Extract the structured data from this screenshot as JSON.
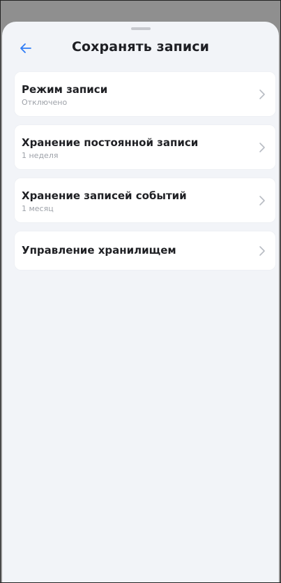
{
  "header": {
    "title": "Сохранять записи",
    "back_icon": "arrow-left-icon"
  },
  "colors": {
    "accent": "#2f7cf6",
    "background": "#f2f4f8",
    "overlay": "#8f8f8f",
    "card": "#ffffff",
    "title_text": "#1e1f24",
    "subtitle_text": "#9ea2a9",
    "chevron": "#b8bcc3"
  },
  "items": [
    {
      "label": "Режим записи",
      "value": "Отключено",
      "icon": "chevron-right-icon"
    },
    {
      "label": "Хранение постоянной записи",
      "value": "1 неделя",
      "icon": "chevron-right-icon"
    },
    {
      "label": "Хранение записей событий",
      "value": "1 месяц",
      "icon": "chevron-right-icon"
    },
    {
      "label": "Управление хранилищем",
      "icon": "chevron-right-icon"
    }
  ]
}
